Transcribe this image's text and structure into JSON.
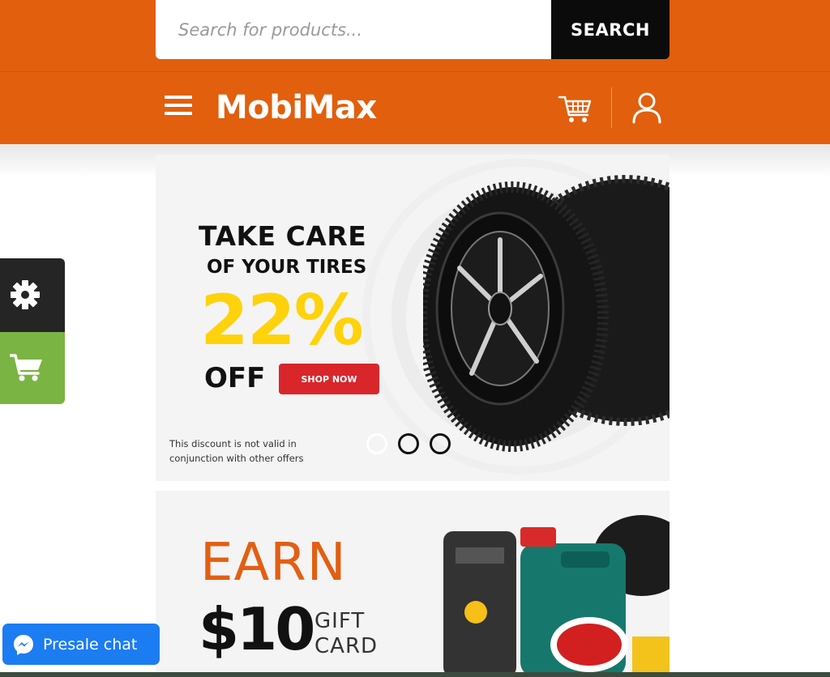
{
  "search": {
    "placeholder": "Search for products...",
    "button_label": "SEARCH"
  },
  "header": {
    "logo": "MobiMax"
  },
  "banner1": {
    "line1": "TAKE CARE",
    "line2": "OF YOUR TIRES",
    "discount": "22%",
    "off": "OFF",
    "cta": "SHOP NOW",
    "note": "This discount is not valid in conjunction with other offers",
    "slides_total": 3,
    "active_slide": 1
  },
  "banner2": {
    "earn": "EARN",
    "amount": "$10",
    "gift_line1": "GIFT",
    "gift_line2": "CARD"
  },
  "chat": {
    "label": "Presale chat"
  },
  "colors": {
    "brand": "#e15f0d",
    "cta_red": "#d8262b",
    "yellow": "#ffd20b",
    "side_green": "#7ab443",
    "chat_blue": "#1c7cf2"
  },
  "icons": [
    "menu-icon",
    "cart-icon",
    "user-icon",
    "gear-icon",
    "side-cart-icon",
    "messenger-icon"
  ]
}
